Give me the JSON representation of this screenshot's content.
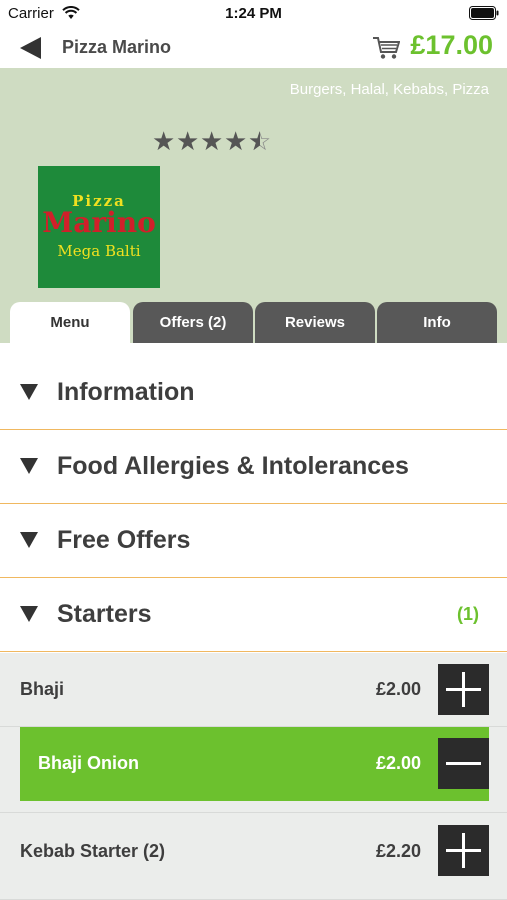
{
  "status_bar": {
    "carrier": "Carrier",
    "time": "1:24 PM"
  },
  "nav": {
    "title": "Pizza Marino",
    "cart_total": "£17.00"
  },
  "header": {
    "cuisines": "Burgers, Halal, Kebabs, Pizza",
    "rating": 4.5,
    "rating_max": 5,
    "logo": {
      "line1": "Pizza",
      "line2": "Marino",
      "line3": "Mega Balti"
    }
  },
  "tabs": [
    {
      "label": "Menu",
      "active": true
    },
    {
      "label": "Offers (2)",
      "active": false
    },
    {
      "label": "Reviews",
      "active": false
    },
    {
      "label": "Info",
      "active": false
    }
  ],
  "sections": [
    {
      "label": "Information",
      "count": ""
    },
    {
      "label": "Food Allergies & Intolerances",
      "count": ""
    },
    {
      "label": "Free Offers",
      "count": ""
    },
    {
      "label": "Starters",
      "count": "(1)"
    }
  ],
  "items": [
    {
      "name": "Bhaji",
      "price": "£2.00",
      "icon": "plus-icon"
    },
    {
      "name": "Bhaji Onion",
      "price": "£2.00",
      "icon": "minus-icon",
      "selected": true
    },
    {
      "name": "Kebab Starter (2)",
      "price": "£2.20",
      "icon": "plus-icon"
    }
  ],
  "colors": {
    "accent": "#6cc12e",
    "header_bg": "#cfdcc2",
    "tab_inactive": "#585858",
    "divider": "#f0b860"
  }
}
